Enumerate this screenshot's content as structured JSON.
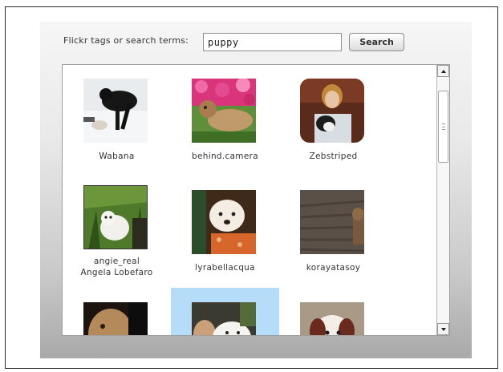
{
  "search": {
    "label": "Flickr tags or search terms:",
    "value": "puppy",
    "button_label": "Search"
  },
  "results": {
    "photos": [
      {
        "caption": "Wabana",
        "caption_line2": "",
        "image": "black dog on snow"
      },
      {
        "caption": "behind.camera",
        "caption_line2": "",
        "image": "puppy on grass with pink flowers"
      },
      {
        "caption": "Zebstriped",
        "caption_line2": "",
        "image": "woman holding black and white puppy"
      },
      {
        "caption": "angie_real",
        "caption_line2": "Angela  Lobefaro",
        "image": "white puppy in grass"
      },
      {
        "caption": "lyrabellacqua",
        "caption_line2": "",
        "image": "fluffy white puppy with orange blanket"
      },
      {
        "caption": "korayatasoy",
        "caption_line2": "",
        "image": "dog on wooden floor"
      },
      {
        "caption": "",
        "caption_line2": "",
        "image": "tan dog close-up"
      },
      {
        "caption": "",
        "caption_line2": "",
        "image": "white puppy held by person",
        "selected": true
      },
      {
        "caption": "",
        "caption_line2": "",
        "image": "shih tzu puppy"
      }
    ]
  },
  "colors": {
    "selection": "#b5dcf8",
    "panel_top": "#f6f6f6",
    "panel_bottom": "#a9a9a9"
  }
}
